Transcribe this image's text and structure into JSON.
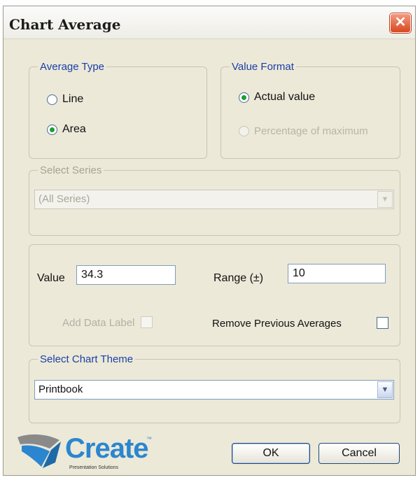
{
  "dialog": {
    "title": "Chart Average",
    "close_glyph": "✕"
  },
  "average_type": {
    "legend": "Average Type",
    "options": [
      {
        "label": "Line",
        "checked": false
      },
      {
        "label": "Area",
        "checked": true
      }
    ]
  },
  "value_format": {
    "legend": "Value Format",
    "options": [
      {
        "label": "Actual value",
        "checked": true,
        "enabled": true
      },
      {
        "label": "Percentage of maximum",
        "checked": false,
        "enabled": false
      }
    ]
  },
  "select_series": {
    "legend": "Select Series",
    "value": "(All Series)",
    "enabled": false
  },
  "values": {
    "value_label": "Value",
    "value": "34.3",
    "range_label": "Range (±)",
    "range": "10",
    "add_data_label": "Add Data Label",
    "add_data_label_checked": false,
    "add_data_label_enabled": false,
    "remove_previous_label": "Remove Previous Averages",
    "remove_previous_checked": false
  },
  "chart_theme": {
    "legend": "Select Chart Theme",
    "value": "Printbook"
  },
  "buttons": {
    "ok": "OK",
    "cancel": "Cancel"
  },
  "logo": {
    "word": "Create",
    "tm": "™",
    "sub": "Presentation Solutions"
  },
  "icons": {
    "close": "close-icon",
    "dropdown": "chevron-down-icon",
    "logo": "create-logo-icon"
  },
  "colors": {
    "dialog_bg": "#ece9d8",
    "legend_text": "#1a3fa8",
    "close_button": "#d8481f",
    "radio_selected": "#1f9b3a",
    "logo_blue": "#2b86cf"
  }
}
